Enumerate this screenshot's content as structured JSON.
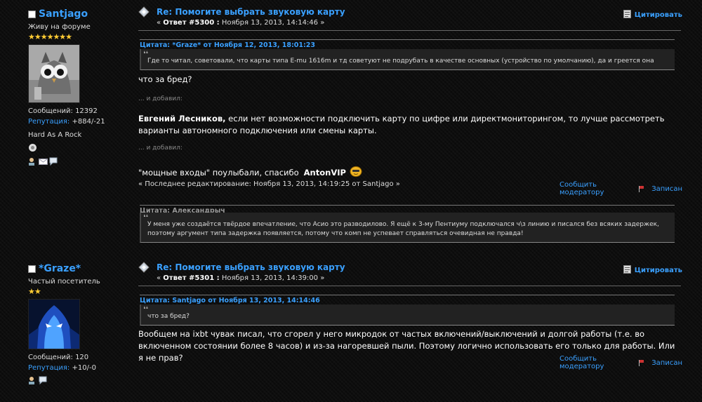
{
  "posts": [
    {
      "author": {
        "name": "Santjago",
        "rank": "Живу на форуме",
        "stars": "★★★★★★★",
        "messages_label": "Сообщений:",
        "messages_count": "12392",
        "reputation_label": "Репутация:",
        "reputation_value": "+884/-21",
        "custom_text": "Hard As A Rock"
      },
      "subject": "Re: Помогите выбрать звуковую карту",
      "meta_prefix": "« ",
      "reply_label": "Ответ #5300 :",
      "date": " Ноября 13, 2013, 14:14:46 »",
      "quote_button": "Цитировать",
      "quotes": [
        {
          "header": "Цитата: *Graze* от Ноября 12, 2013, 18:01:23",
          "text": "Где то читал, советовали, что карты типа E-mu 1616m и тд советуют не подрубать в качестве основных (устройство по умолчанию), да и греется она"
        },
        {
          "header": "Цитата: Александрыч",
          "text": "У меня уже создаётся твёрдое впечатление, что Асио это разводилово. Я ещё к 3-му Пентиуму подключался ч\\з линию и писался без всяких задержек, поэтому аргумент типа задержка появляется, потому что комп не успевает справляться очевидная не правда!"
        }
      ],
      "body1": "что за бред?",
      "added1": "... и добавил:",
      "body2_name": "Евгений Лесников,",
      "body2_text": " если нет возможности подключить карту по цифре или директмониторингом, то лучше рассмотреть варианты автономного подключения или смены карты.",
      "added2": "... и добавил:",
      "body3": "\"мощные входы\" поулыбали, спасибо",
      "body3_mention": "AntonVIP",
      "edit_note": "« Последнее редактирование: Ноября 13, 2013, 14:19:25 от Santjago »",
      "report": "Сообщить модератору",
      "logged": "Записан"
    },
    {
      "author": {
        "name": "*Graze*",
        "rank": "Частый посетитель",
        "stars": "★★",
        "messages_label": "Сообщений:",
        "messages_count": "120",
        "reputation_label": "Репутация:",
        "reputation_value": "+10/-0"
      },
      "subject": "Re: Помогите выбрать звуковую карту",
      "meta_prefix": "« ",
      "reply_label": "Ответ #5301 :",
      "date": " Ноября 13, 2013, 14:39:00 »",
      "quote_button": "Цитировать",
      "quotes": [
        {
          "header": "Цитата: Santjago от Ноября 13, 2013, 14:14:46",
          "text": "что за бред?"
        }
      ],
      "body1": "Вообщем на ixbt чувак писал, что сгорел у него микродок от частых включений/выключений и долгой работы (т.е. во включенном состоянии более 8 часов) и из-за нагоревшей пыли. Поэтому логично использовать его только для работы. Или я не прав?",
      "report": "Сообщить модератору",
      "logged": "Записан"
    }
  ]
}
